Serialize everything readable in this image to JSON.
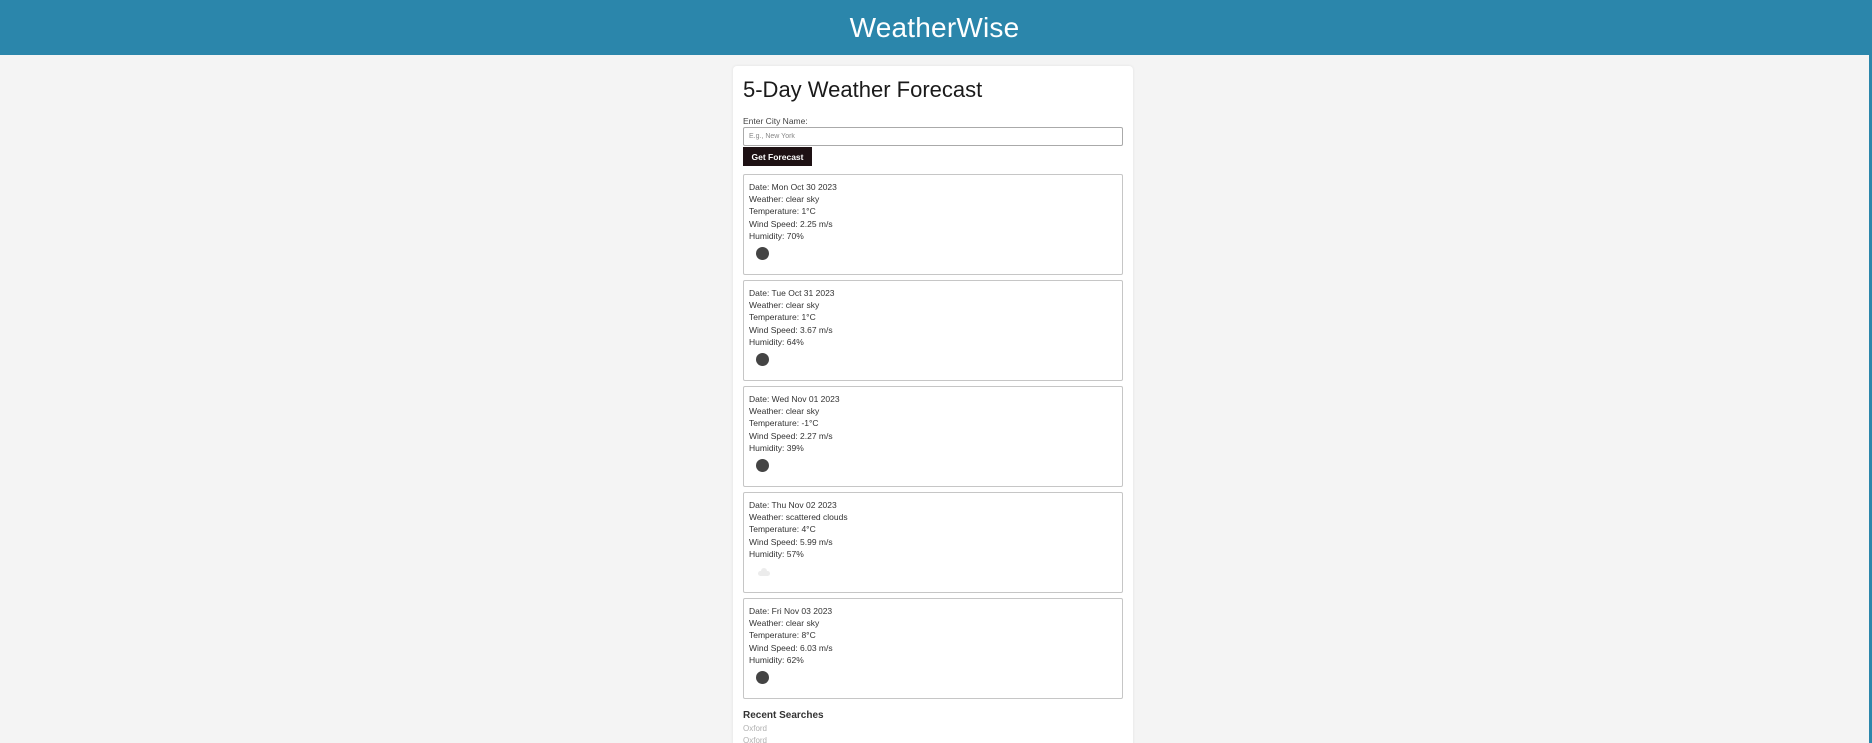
{
  "header": {
    "title": "WeatherWise"
  },
  "main": {
    "title": "5-Day Weather Forecast",
    "city_label": "Enter City Name:",
    "city_placeholder": "E.g., New York",
    "city_value": "",
    "button_label": "Get Forecast"
  },
  "forecast": [
    {
      "date": "Date: Mon Oct 30 2023",
      "weather": "Weather: clear sky",
      "temperature": "Temperature: 1°C",
      "wind": "Wind Speed: 2.25 m/s",
      "humidity": "Humidity: 70%",
      "icon": "clear-sky-icon"
    },
    {
      "date": "Date: Tue Oct 31 2023",
      "weather": "Weather: clear sky",
      "temperature": "Temperature: 1°C",
      "wind": "Wind Speed: 3.67 m/s",
      "humidity": "Humidity: 64%",
      "icon": "clear-sky-icon"
    },
    {
      "date": "Date: Wed Nov 01 2023",
      "weather": "Weather: clear sky",
      "temperature": "Temperature: -1°C",
      "wind": "Wind Speed: 2.27 m/s",
      "humidity": "Humidity: 39%",
      "icon": "clear-sky-icon"
    },
    {
      "date": "Date: Thu Nov 02 2023",
      "weather": "Weather: scattered clouds",
      "temperature": "Temperature: 4°C",
      "wind": "Wind Speed: 5.99 m/s",
      "humidity": "Humidity: 57%",
      "icon": "scattered-clouds-icon"
    },
    {
      "date": "Date: Fri Nov 03 2023",
      "weather": "Weather: clear sky",
      "temperature": "Temperature: 8°C",
      "wind": "Wind Speed: 6.03 m/s",
      "humidity": "Humidity: 62%",
      "icon": "clear-sky-icon"
    }
  ],
  "recent": {
    "title": "Recent Searches",
    "items": [
      "Oxford",
      "Oxford"
    ]
  },
  "colors": {
    "header_bg": "#2b86ab",
    "button_bg": "#1e1114",
    "page_bg": "#f4f4f4"
  }
}
